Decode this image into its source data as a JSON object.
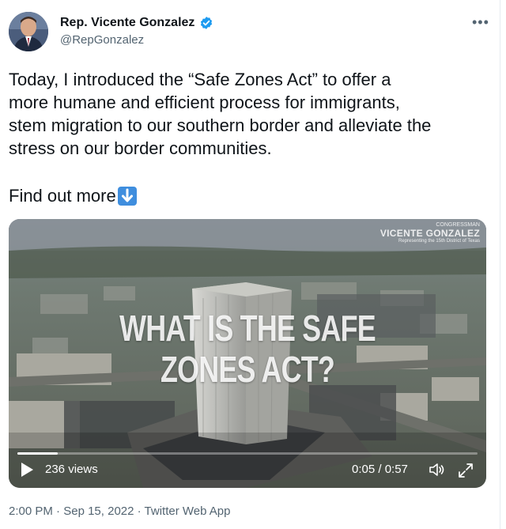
{
  "author": {
    "name": "Rep. Vicente Gonzalez",
    "handle": "@RepGonzalez",
    "verified": true
  },
  "more_icon": "•••",
  "tweet": {
    "lines": [
      "Today, I introduced the “Safe Zones Act” to offer a",
      "more humane and efficient process for immigrants,",
      "stem migration to our southern border and alleviate the",
      "stress on our border communities."
    ],
    "find_more": "Find out more",
    "find_more_emoji": "down-arrow-emoji"
  },
  "video": {
    "title_line1": "WHAT IS THE SAFE",
    "title_line2": "ZONES ACT?",
    "watermark_top": "CONGRESSMAN",
    "watermark_name": "VICENTE GONZALEZ",
    "watermark_sub": "Representing the 15th District of Texas",
    "views": "236 views",
    "time": "0:05 / 0:57",
    "progress_fraction": 0.088
  },
  "meta": {
    "time": "2:00 PM",
    "date": "Sep 15, 2022",
    "source": "Twitter Web App",
    "separator": " · "
  },
  "colors": {
    "verified": "#1d9bf0",
    "secondary_text": "#536471",
    "emoji_blue": "#3f8ede"
  }
}
